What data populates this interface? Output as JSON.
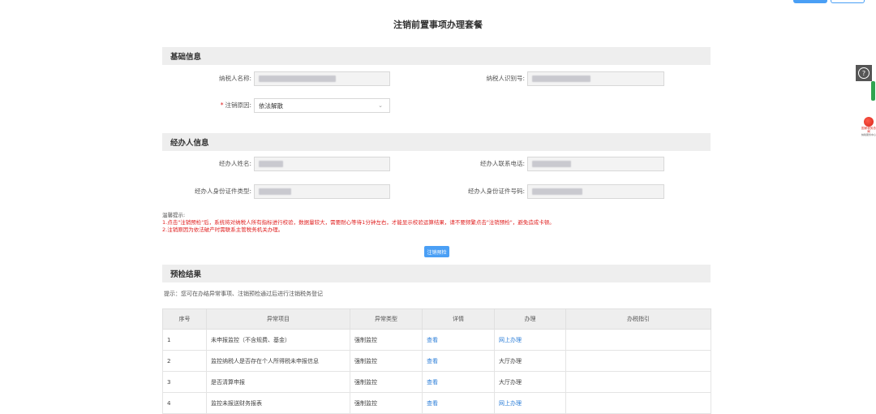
{
  "page_title": "注销前置事项办理套餐",
  "sections": {
    "basic": "基础信息",
    "agent": "经办人信息",
    "result": "预检结果"
  },
  "basic_info": {
    "taxpayer_name_label": "纳税人名称:",
    "taxpayer_id_label": "纳税人识别号:",
    "cancel_reason_label": "注销原因:",
    "cancel_reason_value": "依法解散"
  },
  "agent_info": {
    "name_label": "经办人姓名:",
    "phone_label": "经办人联系电话:",
    "id_type_label": "经办人身份证件类型:",
    "id_number_label": "经办人身份证件号码:"
  },
  "tips": {
    "title": "温馨提示:",
    "line1": "1.点击\"注销预检\"后，系统将对纳税人所有指标进行校验，数据量较大，需要耐心等待1分钟左右，才能显示校验运算结果，请不要频繁点击\"注销预检\"，避免造成卡顿。",
    "line2": "2.注销原因为依法破产时需联系主管税务机关办理。"
  },
  "precheck_button": "注销预检",
  "hint": "提示：您可在办结异常事项、注销预检通过后进行注销税务登记",
  "table": {
    "headers": [
      "序号",
      "异常项目",
      "异常类型",
      "详情",
      "办理",
      "办税指引"
    ],
    "rows": [
      {
        "no": "1",
        "item": "未申报监控（不含规费、基金）",
        "type": "强制监控",
        "detail": "查看",
        "handle": "网上办理",
        "handle_link": true,
        "guide": ""
      },
      {
        "no": "2",
        "item": "监控纳税人是否存在个人所得税未申报信息",
        "type": "强制监控",
        "detail": "查看",
        "handle": "大厅办理",
        "handle_link": false,
        "guide": ""
      },
      {
        "no": "3",
        "item": "是否清算申报",
        "type": "强制监控",
        "detail": "查看",
        "handle": "大厅办理",
        "handle_link": false,
        "guide": ""
      },
      {
        "no": "4",
        "item": "监控未报送财务报表",
        "type": "强制监控",
        "detail": "查看",
        "handle": "网上办理",
        "handle_link": true,
        "guide": ""
      }
    ]
  },
  "side": {
    "help_icon": "question-circle-icon",
    "logo_text": "国家税务总局",
    "logo_sub": "纳税服务中心"
  },
  "colors": {
    "primary": "#4a9ff5",
    "link": "#2e7fd8",
    "danger": "#e02020",
    "section_bg": "#eeeeee"
  }
}
